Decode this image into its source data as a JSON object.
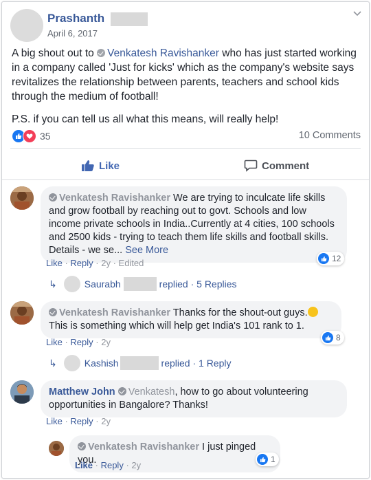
{
  "post": {
    "author_first": "Prashanth",
    "date": "April 6, 2017",
    "text_prefix": "A big shout out to ",
    "mention": "Venkatesh Ravishanker",
    "text_suffix": " who has just started working in a company called 'Just for kicks' which as the company's website says revitalizes the relationship between parents, teachers and school kids through the medium of football!",
    "text_p2": "P.S. if you can tell us all what this means, will really help!",
    "reaction_count": "35",
    "comments_count": "10 Comments",
    "like_label": "Like",
    "comment_label": "Comment"
  },
  "comments": [
    {
      "name": "Venkatesh Ravishanker",
      "text": " We are trying to inculcate life skills and grow football by reaching out to govt. Schools and low income private schools in India..Currently at 4 cities, 100 schools and 2500 kids - trying to teach them life skills and football skills. Details - we se... ",
      "see_more": "See More",
      "like": "Like",
      "reply": "Reply",
      "age": "2y",
      "edited": "Edited",
      "reactions": "12",
      "reply_summary": {
        "name": "Saurabh",
        "text": "replied · 5 Replies"
      }
    },
    {
      "name": "Venkatesh Ravishanker",
      "text": " Thanks for the shout-out guys.",
      "text2": "This is something which will help get India's 101 rank to 1.",
      "like": "Like",
      "reply": "Reply",
      "age": "2y",
      "reactions": "8",
      "reply_summary": {
        "name": "Kashish",
        "text": "replied · 1 Reply"
      }
    },
    {
      "name": "Matthew John",
      "mention": "Venkatesh",
      "text": ", how to go about volunteering opportunities in Bangalore? Thanks!",
      "like": "Like",
      "reply": "Reply",
      "age": "2y"
    }
  ],
  "nested_reply": {
    "name": "Venkatesh Ravishanker",
    "text": " I just pinged you.",
    "like": "Like",
    "reply": "Reply",
    "age": "2y",
    "reactions": "1"
  },
  "colors": {
    "link": "#385898",
    "like_blue": "#1877f2",
    "love_red": "#f33e58",
    "bubble": "#f2f3f5"
  }
}
